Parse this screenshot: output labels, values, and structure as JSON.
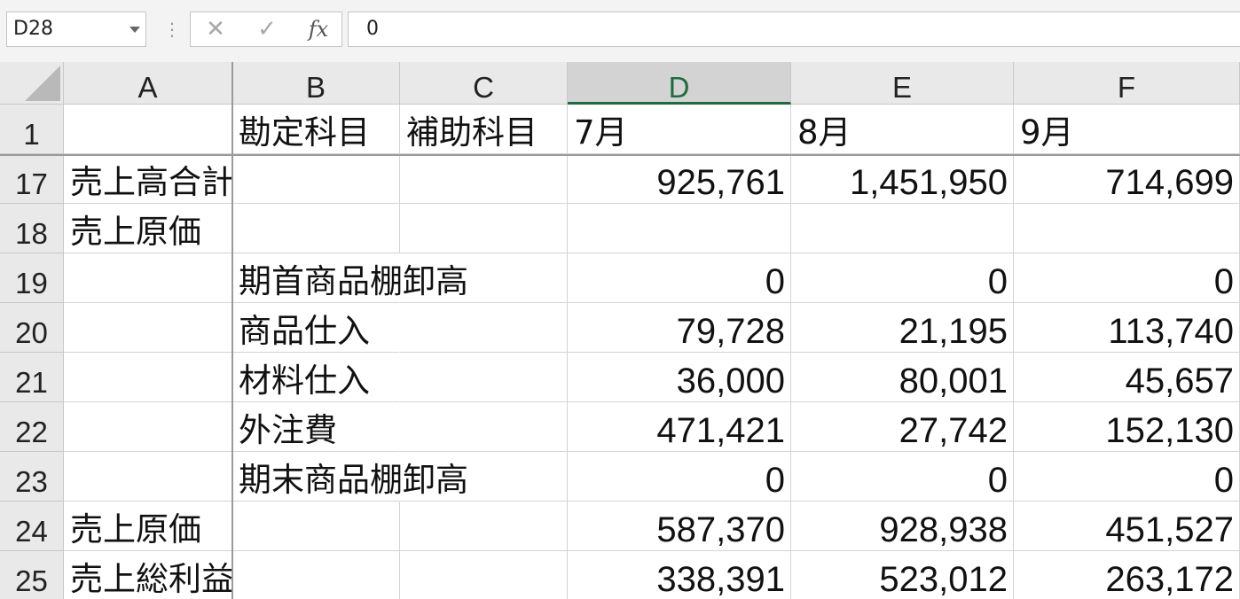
{
  "formula_bar": {
    "name_box": "D28",
    "cancel_glyph": "✕",
    "enter_glyph": "✓",
    "fx_label": "fx",
    "formula_value": "0"
  },
  "columns": [
    "A",
    "B",
    "C",
    "D",
    "E",
    "F"
  ],
  "active_column": "D",
  "rows": [
    {
      "num": "1",
      "A": "",
      "B": "勘定科目",
      "C": "補助科目",
      "D": "7月",
      "E": "8月",
      "F": "9月"
    },
    {
      "num": "17",
      "A": "売上高合計",
      "B": "",
      "C": "",
      "D": "925,761",
      "E": "1,451,950",
      "F": "714,699"
    },
    {
      "num": "18",
      "A": "売上原価",
      "B": "",
      "C": "",
      "D": "",
      "E": "",
      "F": ""
    },
    {
      "num": "19",
      "A": "",
      "B": "期首商品棚卸高",
      "C": "",
      "D": "0",
      "E": "0",
      "F": "0"
    },
    {
      "num": "20",
      "A": "",
      "B": "商品仕入",
      "C": "",
      "D": "79,728",
      "E": "21,195",
      "F": "113,740"
    },
    {
      "num": "21",
      "A": "",
      "B": "材料仕入",
      "C": "",
      "D": "36,000",
      "E": "80,001",
      "F": "45,657"
    },
    {
      "num": "22",
      "A": "",
      "B": "外注費",
      "C": "",
      "D": "471,421",
      "E": "27,742",
      "F": "152,130"
    },
    {
      "num": "23",
      "A": "",
      "B": "期末商品棚卸高",
      "C": "",
      "D": "0",
      "E": "0",
      "F": "0"
    },
    {
      "num": "24",
      "A": "売上原価",
      "B": "",
      "C": "",
      "D": "587,370",
      "E": "928,938",
      "F": "451,527"
    },
    {
      "num": "25",
      "A": "売上総利益",
      "B": "",
      "C": "",
      "D": "338,391",
      "E": "523,012",
      "F": "263,172"
    }
  ],
  "colors": {
    "active_header_text": "#1e6b3e",
    "header_bg": "#e9e9e9",
    "active_header_bg": "#d3d3d3",
    "grid_line": "#d4d4d4"
  },
  "icons": {
    "name_box_dropdown": "chevron-down-icon",
    "cancel": "close-icon",
    "enter": "check-icon",
    "function": "fx-icon",
    "select_all": "select-all-triangle-icon"
  }
}
